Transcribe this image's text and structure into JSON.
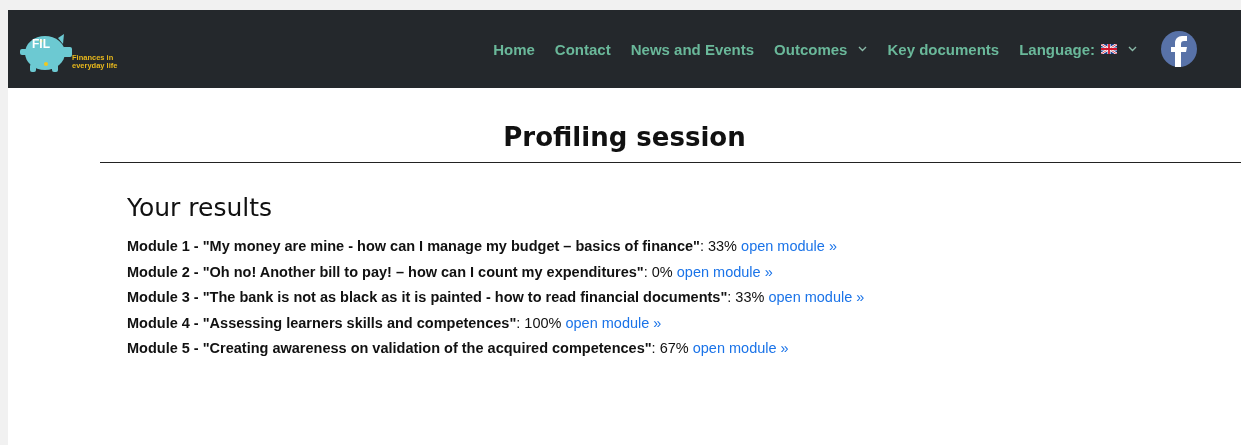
{
  "logo": {
    "badge": "FIL",
    "tagline_lines": [
      "Finances in",
      "everyday life"
    ]
  },
  "nav": [
    {
      "label": "Home",
      "dropdown": false,
      "flag": false
    },
    {
      "label": "Contact",
      "dropdown": false,
      "flag": false
    },
    {
      "label": "News and Events",
      "dropdown": false,
      "flag": false
    },
    {
      "label": "Outcomes",
      "dropdown": true,
      "flag": false
    },
    {
      "label": "Key documents",
      "dropdown": false,
      "flag": false
    },
    {
      "label": "Language:",
      "dropdown": true,
      "flag": true
    }
  ],
  "page_title": "Profiling session",
  "results": {
    "heading": "Your results",
    "modules": [
      {
        "text": "**Module 1 - \"My money are mine - how can I manage my budget – basics of finance\"**: 33%",
        "link": "open module »"
      },
      {
        "text": "**Module 2 - \"Oh no! Another bill to pay! – how can I count my expenditures\"**: 0%",
        "link": "open module »"
      },
      {
        "text": "**Module 3 - \"The bank is not as black as it is painted - how to read financial documents\"**: 33%",
        "link": "open module »"
      },
      {
        "text": "**Module 4 - \"Assessing learners skills and competences\"**: 100%",
        "link": "open module »"
      },
      {
        "text": "**Module 5 - \"Creating awareness on validation of the acquired competences\"**: 67%",
        "link": "open module »"
      }
    ]
  }
}
